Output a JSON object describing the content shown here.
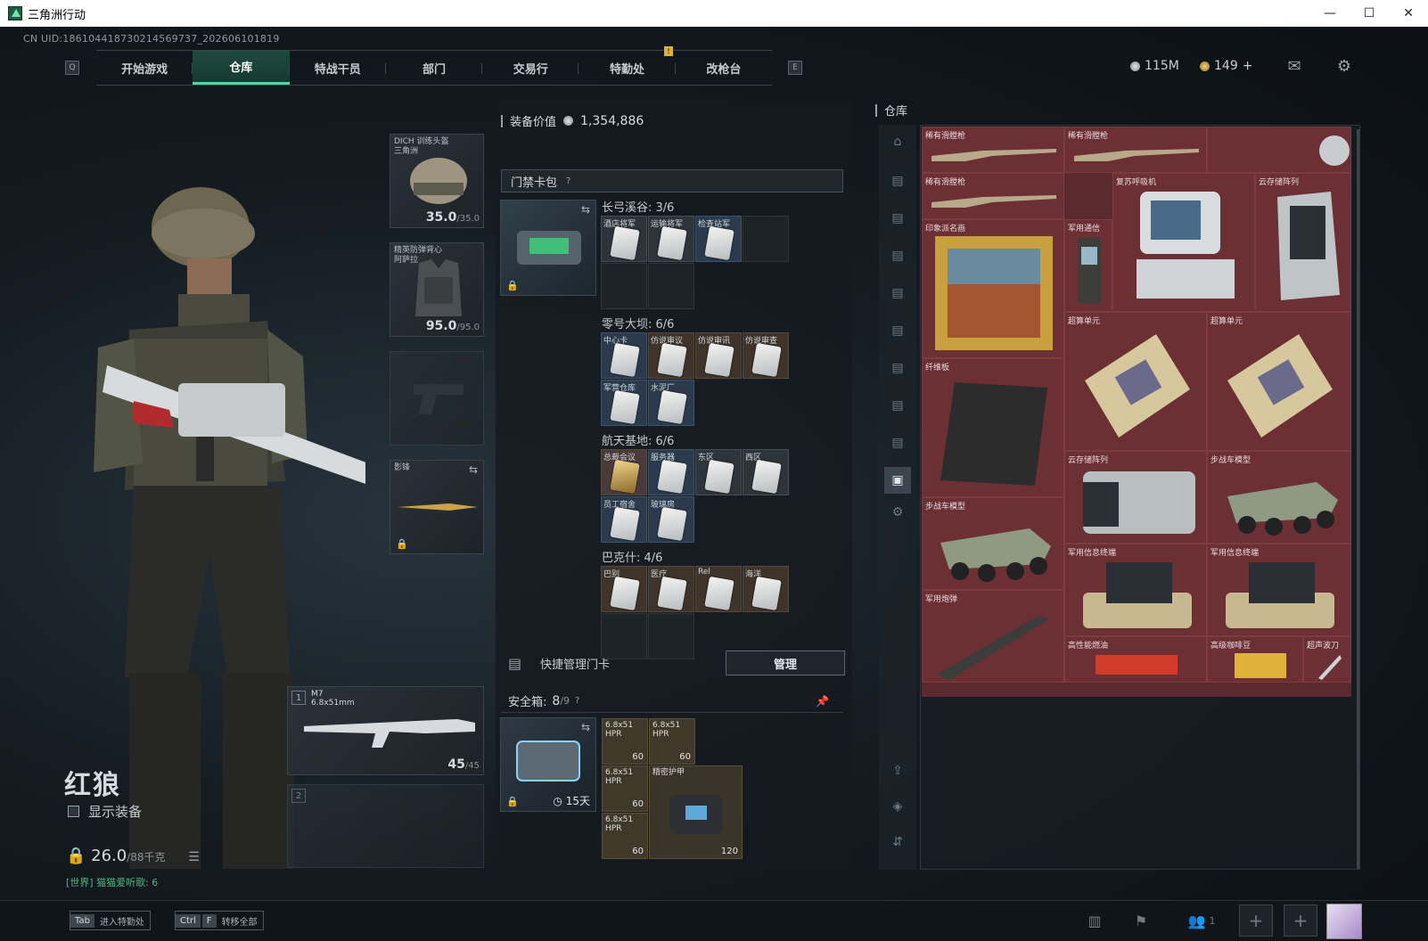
{
  "window": {
    "title": "三角洲行动"
  },
  "uid": "CN UID:1861044187302145697​37_202606101819",
  "nav": {
    "left_key": "Q",
    "right_key": "E",
    "tabs": [
      "开始游戏",
      "仓库",
      "特战干员",
      "部门",
      "交易行",
      "特勤处",
      "改枪台"
    ],
    "active": "仓库",
    "notif": "!"
  },
  "currency": {
    "silver": "115M",
    "coupons": "149",
    "plus": "+"
  },
  "operator": {
    "name": "红狼",
    "show_equipment": "显示装备",
    "weight": "26.0",
    "weight_max": "/88千克",
    "world": "[世界] 猫猫爱听歌: 6"
  },
  "slots": {
    "helmet": {
      "label": "DICH 训练头盔\n三角洲",
      "durability": "35.0",
      "max": "/35.0"
    },
    "armor": {
      "label": "精英防弹背心\n阿萨拉",
      "durability": "95.0",
      "max": "/95.0"
    },
    "melee": {
      "label": "影锋"
    },
    "weapon1": {
      "num": "1",
      "name": "M7",
      "caliber": "6.8x51mm",
      "ammo": "45",
      "ammo_max": "/45"
    },
    "weapon2": {
      "num": "2"
    }
  },
  "loadout": {
    "value_label": "装备价值",
    "value": "1,354,886",
    "card_pack": "门禁卡包",
    "help": "?",
    "groups": [
      {
        "name": "长弓溪谷: 3/6",
        "cards": [
          "酒店将军",
          "运输将军",
          "检查站军"
        ]
      },
      {
        "name": "零号大坝: 6/6",
        "cards": [
          "中心卡",
          "仿说审议",
          "仿说审讯",
          "仿说审查",
          "军营仓库",
          "水泥厂"
        ]
      },
      {
        "name": "航天基地: 6/6",
        "cards": [
          "总裁会议",
          "服务器",
          "东区",
          "西区",
          "员工宿舍",
          "玻璃房"
        ]
      },
      {
        "name": "巴克什: 4/6",
        "cards": [
          "巴别",
          "医疗",
          "Rel",
          "海洋"
        ]
      }
    ],
    "quick_manage": "快捷管理门卡",
    "manage_button": "管理",
    "safebox_label": "安全箱:",
    "safebox_count": "8",
    "safebox_max": "/9",
    "safebox_timer": "15天",
    "ammo": [
      {
        "name": "6.8x51\nHPR",
        "count": "60"
      },
      {
        "name": "6.8x51\nHPR",
        "count": "60"
      },
      {
        "name": "6.8x51\nHPR",
        "count": "60"
      },
      {
        "name": "6.8x51\nHPR",
        "count": "60"
      }
    ],
    "armor_plate": {
      "name": "精密护甲",
      "count": "120"
    }
  },
  "stash": {
    "title": "仓库",
    "items": [
      "稀有滑膛枪",
      "稀有滑膛枪",
      "稀有滑膛枪",
      "复苏呼吸机",
      "云存储阵列",
      "印象派名画",
      "军用通信",
      "超算单元",
      "超算单元",
      "纤维板",
      "云存储阵列",
      "步战车模型",
      "步战车模型",
      "军用信息终端",
      "军用信息终端",
      "军用炮弹",
      "高性能燃油",
      "高级咖啡豆",
      "超声波刀"
    ]
  },
  "bottom": {
    "tab_key": "Tab",
    "tab_label": "进入特勤处",
    "ctrl_key": "Ctrl",
    "f_key": "F",
    "ctrl_label": "转移全部",
    "friends": "1"
  }
}
